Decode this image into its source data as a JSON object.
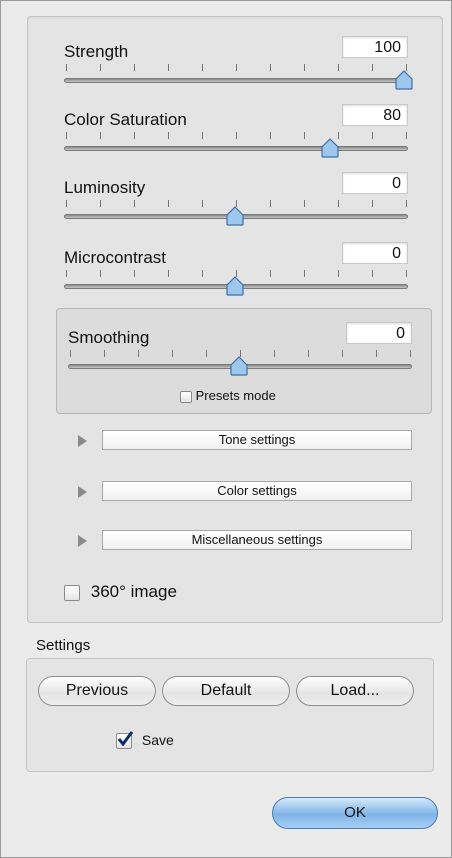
{
  "sliders": [
    {
      "label": "Strength",
      "value": "100",
      "level": 1.0
    },
    {
      "label": "Color Saturation",
      "value": "80",
      "level": 0.78
    },
    {
      "label": "Luminosity",
      "value": "0",
      "level": 0.5
    },
    {
      "label": "Microcontrast",
      "value": "0",
      "level": 0.5
    }
  ],
  "smoothing": {
    "label": "Smoothing",
    "value": "0",
    "level": 0.5,
    "presets_label": "Presets mode",
    "presets_checked": false
  },
  "sections": [
    "Tone settings",
    "Color settings",
    "Miscellaneous settings"
  ],
  "image360": {
    "label": "360° image",
    "checked": false
  },
  "settings": {
    "title": "Settings",
    "previous_label": "Previous",
    "default_label": "Default",
    "load_label": "Load...",
    "save_label": "Save",
    "save_checked": true
  },
  "ok_label": "OK",
  "colors": {
    "accent": "#7fb3e7",
    "thumb": "#9ec7ef"
  }
}
